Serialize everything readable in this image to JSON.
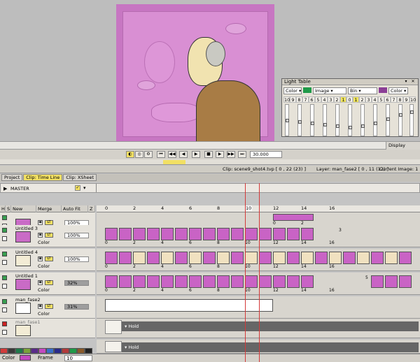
{
  "lighttable": {
    "title": "Light Table",
    "mode": "Color",
    "type": "Image",
    "blend": "Bin",
    "right_mode": "Color",
    "numbers": [
      "10",
      "9",
      "8",
      "7",
      "6",
      "5",
      "4",
      "3",
      "2",
      "1",
      "0",
      "1",
      "2",
      "3",
      "4",
      "5",
      "6",
      "7",
      "8",
      "9",
      "10"
    ],
    "accent_green": "#1f9a49",
    "accent_purple": "#8b3e96"
  },
  "statusbar": {
    "display": "Display"
  },
  "toolbar": {
    "speed": "30.000"
  },
  "info": {
    "clip": "Clip: scene9_shot4.tvp [ 0 , 22  (23) ]",
    "layer": "Layer: man_fase2 [ 0 , 11  (12) ]",
    "current": "Current Image: 1"
  },
  "tabs": [
    {
      "label": "Project"
    },
    {
      "label": "Clip: Time Line"
    },
    {
      "label": "Clip: XSheet"
    }
  ],
  "master": {
    "label": "MASTER"
  },
  "header": {
    "h": "H",
    "s": "S",
    "new": "New",
    "merge": "Merge",
    "autofit": "Auto Fit",
    "z": "Z"
  },
  "ruler_ticks": [
    "0",
    "2",
    "4",
    "6",
    "8",
    "10",
    "12",
    "14",
    "16"
  ],
  "layers": [
    {
      "name": "",
      "opacity": "100%",
      "color": "Color",
      "lt": "LT"
    },
    {
      "name": "Untitled 3",
      "opacity": "100%",
      "color": "Color",
      "lt": "LT",
      "end": "3"
    },
    {
      "name": "Untitled 4",
      "opacity": "100%",
      "color": "Color",
      "lt": "LT"
    },
    {
      "name": "Untitled 1",
      "opacity": "32%",
      "color": "Color",
      "lt": "LT",
      "end": "5"
    },
    {
      "name": "man_fase2",
      "opacity": "31%",
      "color": "Color",
      "lt": "LT"
    },
    {
      "name": "man_fase1",
      "opacity": "",
      "color": "",
      "lt": ""
    }
  ],
  "hold_label": "Hold",
  "track_numbers": [
    "0",
    "2",
    "4",
    "6",
    "8",
    "10",
    "12",
    "14",
    "16"
  ],
  "bottom": {
    "color": "Color",
    "frame": "Frame",
    "frame_value": "10"
  },
  "palette": [
    "#d23b3b",
    "#3a3a3a",
    "#1f7a4a",
    "#7aa23a",
    "#5a2a8a",
    "#c34ac0",
    "#3a6ec7",
    "#2a2a8a",
    "#b33a3a",
    "#1f9a49",
    "#8a5a2a",
    "#222222"
  ]
}
